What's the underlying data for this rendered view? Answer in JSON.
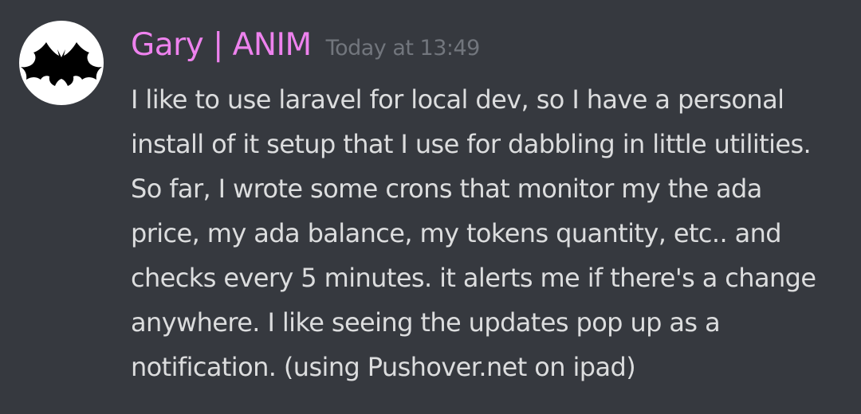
{
  "message": {
    "avatar_icon": "bat-icon",
    "author": "Gary | ANIM",
    "author_color": "#ee82ee",
    "timestamp": "Today at 13:49",
    "lines": [
      "I like to use laravel for local dev, so I have a personal",
      "install of it setup that I use for dabbling in little utilities.",
      "So far, I wrote some crons that monitor my the ada",
      "price, my ada balance, my tokens quantity, etc.. and",
      "checks every 5 minutes. it alerts me if there's a change",
      "anywhere. I like seeing the updates pop up as a",
      "notification. (using Pushover.net on ipad)"
    ]
  },
  "colors": {
    "background": "#36393f",
    "text": "#dcddde",
    "timestamp": "#72767d"
  }
}
